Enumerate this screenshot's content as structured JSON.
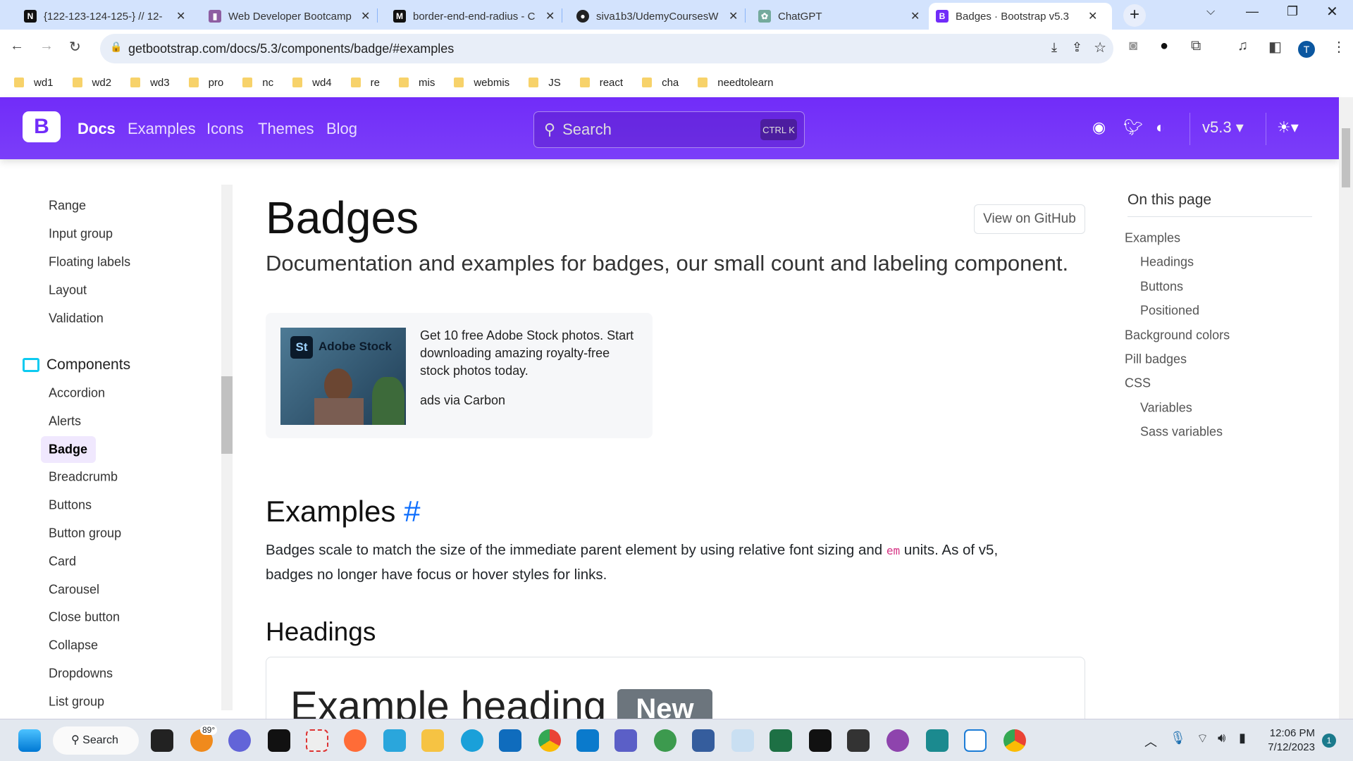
{
  "browser": {
    "tabs": [
      {
        "title": "{122-123-124-125-} // 12-",
        "icon": "notion-icon",
        "color": "#111"
      },
      {
        "title": "Web Developer Bootcamp",
        "icon": "trello-icon",
        "color": "#8e5ea2"
      },
      {
        "title": "border-end-end-radius - C",
        "icon": "mdn-icon",
        "color": "#111"
      },
      {
        "title": "siva1b3/UdemyCoursesW",
        "icon": "github-icon",
        "color": "#222"
      },
      {
        "title": "ChatGPT",
        "icon": "chatgpt-icon",
        "color": "#74aa9c"
      },
      {
        "title": "Badges · Bootstrap v5.3",
        "icon": "bootstrap-icon",
        "color": "#712cf9"
      }
    ],
    "url": "getbootstrap.com/docs/5.3/components/badge/#examples",
    "profile_initial": "T",
    "bookmarks": [
      "wd1",
      "wd2",
      "wd3",
      "pro",
      "nc",
      "wd4",
      "re",
      "mis",
      "webmis",
      "JS",
      "react",
      "cha",
      "needtolearn"
    ]
  },
  "navbar": {
    "logo": "B",
    "links": [
      "Docs",
      "Examples",
      "Icons",
      "Themes",
      "Blog"
    ],
    "search_placeholder": "Search",
    "shortcut": "CTRL K",
    "version": "v5.3"
  },
  "sidebar": {
    "forms_items": [
      "Range",
      "Input group",
      "Floating labels",
      "Layout",
      "Validation"
    ],
    "section": "Components",
    "component_items": [
      "Accordion",
      "Alerts",
      "Badge",
      "Breadcrumb",
      "Buttons",
      "Button group",
      "Card",
      "Carousel",
      "Close button",
      "Collapse",
      "Dropdowns",
      "List group"
    ],
    "active": "Badge"
  },
  "main": {
    "title": "Badges",
    "view_github": "View on GitHub",
    "lead": "Documentation and examples for badges, our small count and labeling component.",
    "ad": {
      "brand": "Adobe Stock",
      "brand_mark": "St",
      "text": "Get 10 free Adobe Stock photos. Start downloading amazing royalty-free stock photos today.",
      "via": "ads via Carbon"
    },
    "examples_heading": "Examples",
    "anchor": "#",
    "examples_text_1": "Badges scale to match the size of the immediate parent element by using relative font sizing and",
    "examples_code": "em",
    "examples_text_2": "units. As of v5,",
    "examples_text_3": "badges no longer have focus or hover styles for links.",
    "headings_heading": "Headings",
    "example_heading": "Example heading",
    "badge_new": "New"
  },
  "toc": {
    "title": "On this page",
    "items": [
      {
        "label": "Examples",
        "level": 1
      },
      {
        "label": "Headings",
        "level": 2
      },
      {
        "label": "Buttons",
        "level": 2
      },
      {
        "label": "Positioned",
        "level": 2
      },
      {
        "label": "Background colors",
        "level": 1
      },
      {
        "label": "Pill badges",
        "level": 1
      },
      {
        "label": "CSS",
        "level": 1
      },
      {
        "label": "Variables",
        "level": 2
      },
      {
        "label": "Sass variables",
        "level": 2
      }
    ]
  },
  "taskbar": {
    "search": "Search",
    "weather": "89°",
    "time": "12:06 PM",
    "date": "7/12/2023",
    "notifications": "1"
  }
}
